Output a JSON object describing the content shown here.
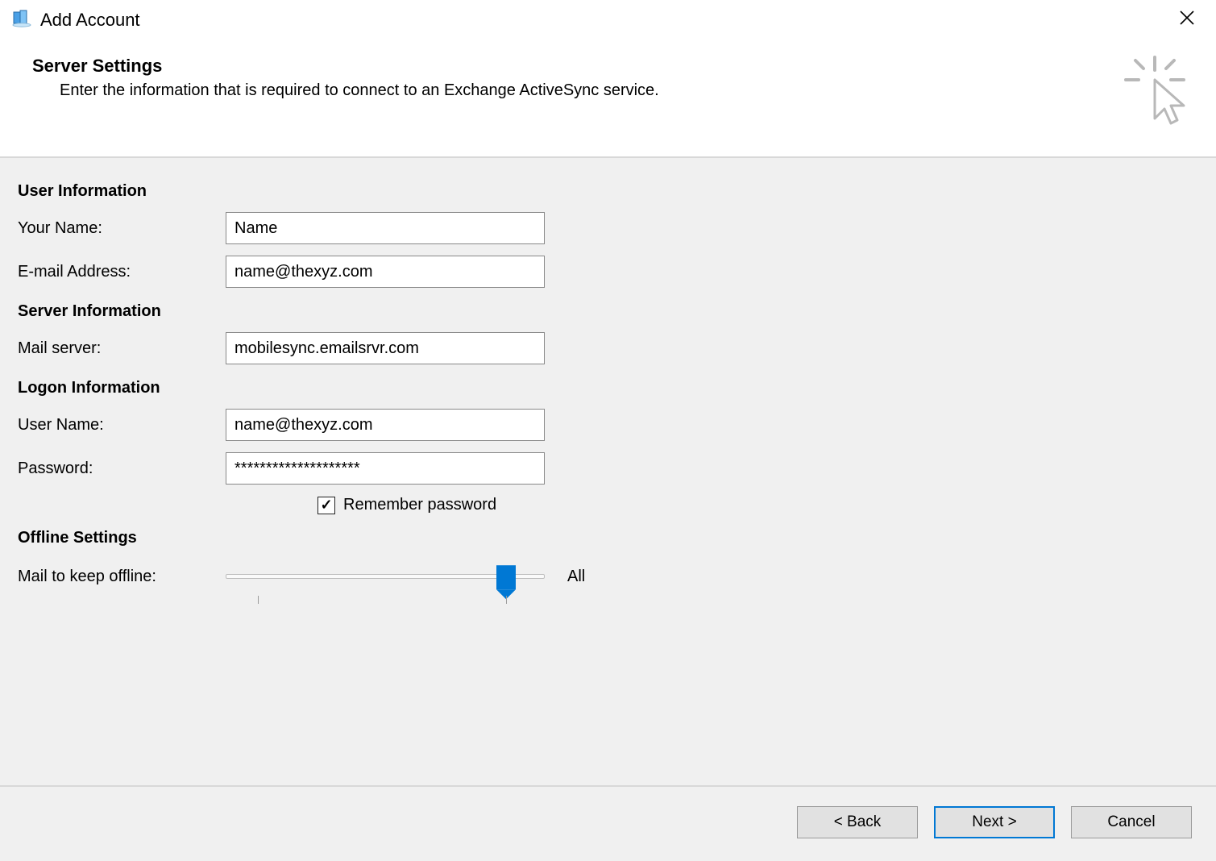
{
  "window": {
    "title": "Add Account"
  },
  "header": {
    "title": "Server Settings",
    "subtitle": "Enter the information that is required to connect to an Exchange ActiveSync service."
  },
  "sections": {
    "user_info": "User Information",
    "server_info": "Server Information",
    "logon_info": "Logon Information",
    "offline": "Offline Settings"
  },
  "fields": {
    "your_name": {
      "label": "Your Name:",
      "value": "Name"
    },
    "email": {
      "label": "E-mail Address:",
      "value": "name@thexyz.com"
    },
    "mail_server": {
      "label": "Mail server:",
      "value": "mobilesync.emailsrvr.com"
    },
    "user_name": {
      "label": "User Name:",
      "value": "name@thexyz.com"
    },
    "password": {
      "label": "Password:",
      "value": "********************"
    },
    "remember": {
      "label": "Remember password",
      "checked": true
    },
    "offline_mail": {
      "label": "Mail to keep offline:",
      "value_label": "All",
      "value_percent": 88
    }
  },
  "buttons": {
    "back": "< Back",
    "next": "Next >",
    "cancel": "Cancel"
  }
}
